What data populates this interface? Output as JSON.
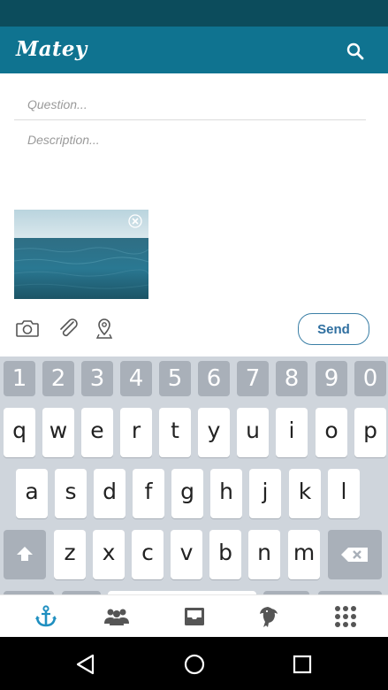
{
  "app_bar": {
    "title": "Matey",
    "search_icon": "search-icon",
    "color": "#0f7390",
    "status_color": "#0c4c5c"
  },
  "form": {
    "question_placeholder": "Question...",
    "description_placeholder": "Description..."
  },
  "attachment": {
    "description": "photo-thumbnail",
    "remove_icon": "close-icon"
  },
  "toolbar": {
    "icons": [
      "camera-icon",
      "paperclip-icon",
      "location-pin-icon"
    ],
    "send_label": "Send",
    "send_color": "#2f6fa0"
  },
  "keyboard": {
    "numbers": [
      "1",
      "2",
      "3",
      "4",
      "5",
      "6",
      "7",
      "8",
      "9",
      "0"
    ],
    "row1": [
      "q",
      "w",
      "e",
      "r",
      "t",
      "y",
      "u",
      "i",
      "o",
      "p"
    ],
    "row2": [
      "a",
      "s",
      "d",
      "f",
      "g",
      "h",
      "j",
      "k",
      "l"
    ],
    "row3": [
      "z",
      "x",
      "c",
      "v",
      "b",
      "n",
      "m"
    ],
    "shift_icon": "shift-icon",
    "backspace_icon": "backspace-icon"
  },
  "bottom_nav": {
    "items": [
      "anchor-icon",
      "people-icon",
      "inbox-icon",
      "parrot-icon",
      "grid-icon"
    ],
    "active": "anchor-icon",
    "active_color": "#1f8fc0"
  },
  "system_nav": {
    "items": [
      "back-icon",
      "home-icon",
      "recents-icon"
    ]
  }
}
